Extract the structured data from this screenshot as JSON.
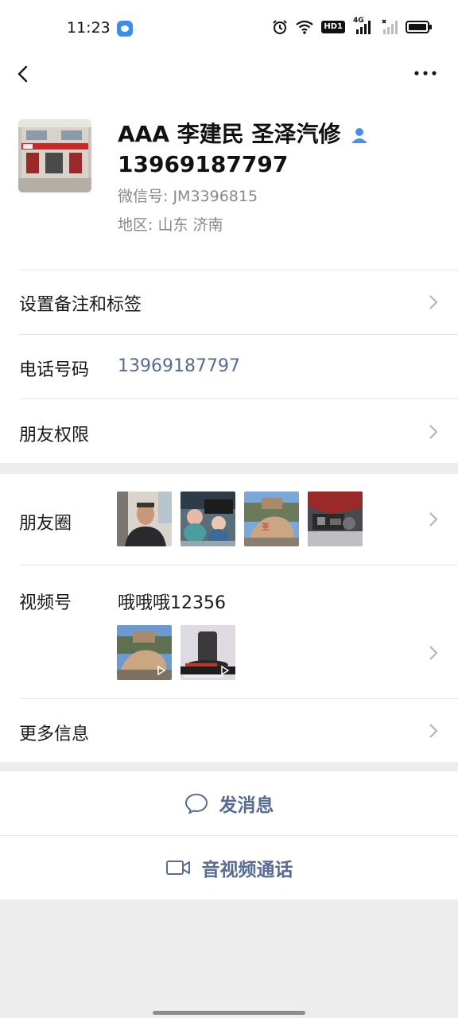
{
  "status_bar": {
    "time": "11:23",
    "network_label": "4G",
    "hd_label": "HD1"
  },
  "profile": {
    "name": "AAA 李建民 圣泽汽修 13969187797",
    "wechat_id": "微信号:  JM3396815",
    "region": "地区:  山东  济南"
  },
  "rows": {
    "remark_label": "设置备注和标签",
    "phone_label": "电话号码",
    "phone_value": "13969187797",
    "permission_label": "朋友权限",
    "moments_label": "朋友圈",
    "channels_label": "视频号",
    "channels_name": "哦哦哦12356",
    "more_info_label": "更多信息"
  },
  "actions": {
    "send_message": "发消息",
    "video_call": "音视频通话"
  },
  "colors": {
    "link_blue": "#576b95",
    "background": "#ededed",
    "contact_icon": "#4a8ee6"
  }
}
